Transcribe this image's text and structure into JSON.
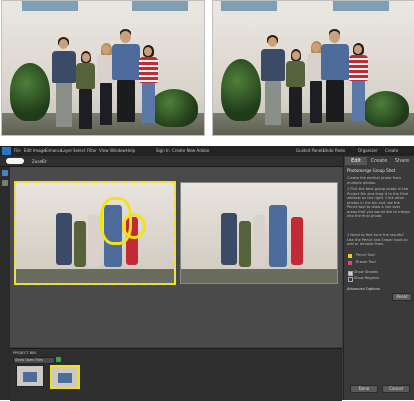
{
  "menubar": {
    "items": [
      "File",
      "Edit",
      "Image",
      "Enhance",
      "Layer",
      "Select",
      "Filter",
      "View",
      "Window",
      "Help"
    ],
    "sign_in": "Sign In",
    "create_account": "Create New Adobe",
    "right_items": [
      "Guided Panels",
      "Undo",
      "Redo",
      "Organizer",
      "Create"
    ]
  },
  "toolbar": {
    "zoom_label": "Zoom",
    "zoom_value": "Fit"
  },
  "right_panel": {
    "tabs": [
      "Edit",
      "Create",
      "Share"
    ],
    "title": "Photomerge Group Shot",
    "description": "Create the perfect photo from multiple photos.",
    "steps": [
      "1 Pick the best group photo in the Project Bin and drag it to the Final window on the right. Click other photos in the bin and use the Pencil tool to draw a line over areas that you would like to merge into the final photo.",
      "2 Need to fine tune the results? Use the Pencil and Eraser tools to add or remove lines."
    ],
    "tools": [
      "Pencil Tool",
      "Eraser Tool"
    ],
    "checkboxes": [
      "Show Strokes",
      "Show Regions"
    ],
    "advanced_label": "Advanced Options",
    "reset_label": "Reset",
    "done_label": "Done",
    "cancel_label": "Cancel"
  },
  "project_bin": {
    "label": "PROJECT BIN",
    "dropdown": "Show Open Files"
  },
  "colors": {
    "accent_yellow": "#f2e21a",
    "brand_blue": "#2a77c0",
    "panel_bg": "#3a3a3a"
  }
}
